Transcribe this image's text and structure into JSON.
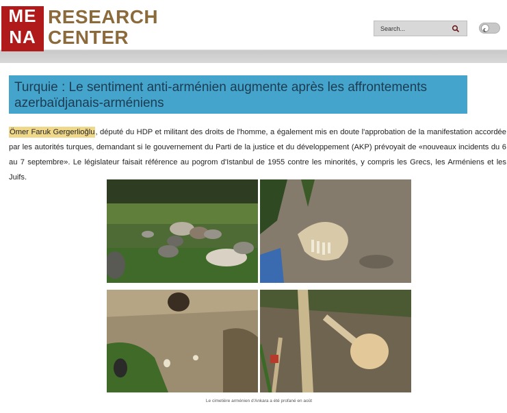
{
  "header": {
    "logo_line1": "ME",
    "logo_line2": "NA",
    "brand_line1": "RESEARCH",
    "brand_line2": "CENTER",
    "search_placeholder": "Search..."
  },
  "article": {
    "title": "Turquie : Le sentiment anti-arménien augmente après les affrontements azerbaïdjanais-arméniens",
    "author_name": "Ömer Faruk Gergerlioğlu",
    "paragraph_rest": ", député du HDP et militant des droits de l'homme, a également mis en doute l'approbation de la manifestation accordée par les autorités turques, demandant si le gouvernement du Parti de la justice et du développement (AKP) prévoyait de «nouveaux incidents du 6 au 7 septembre». Le législateur faisait référence au pogrom d'Istanbul de 1955 contre les minorités, y compris les Grecs, les Arméniens et les Juifs.",
    "caption": "Le cimetière arménien d'Ankara a été profané en août"
  },
  "colors": {
    "logo_red": "#b11a1a",
    "brand_brown": "#8b6a3b",
    "title_blue": "#44a4cc",
    "title_text": "#1d3c52",
    "highlight": "#f0d88a"
  },
  "icons": [
    "search-icon",
    "moon-icon"
  ]
}
